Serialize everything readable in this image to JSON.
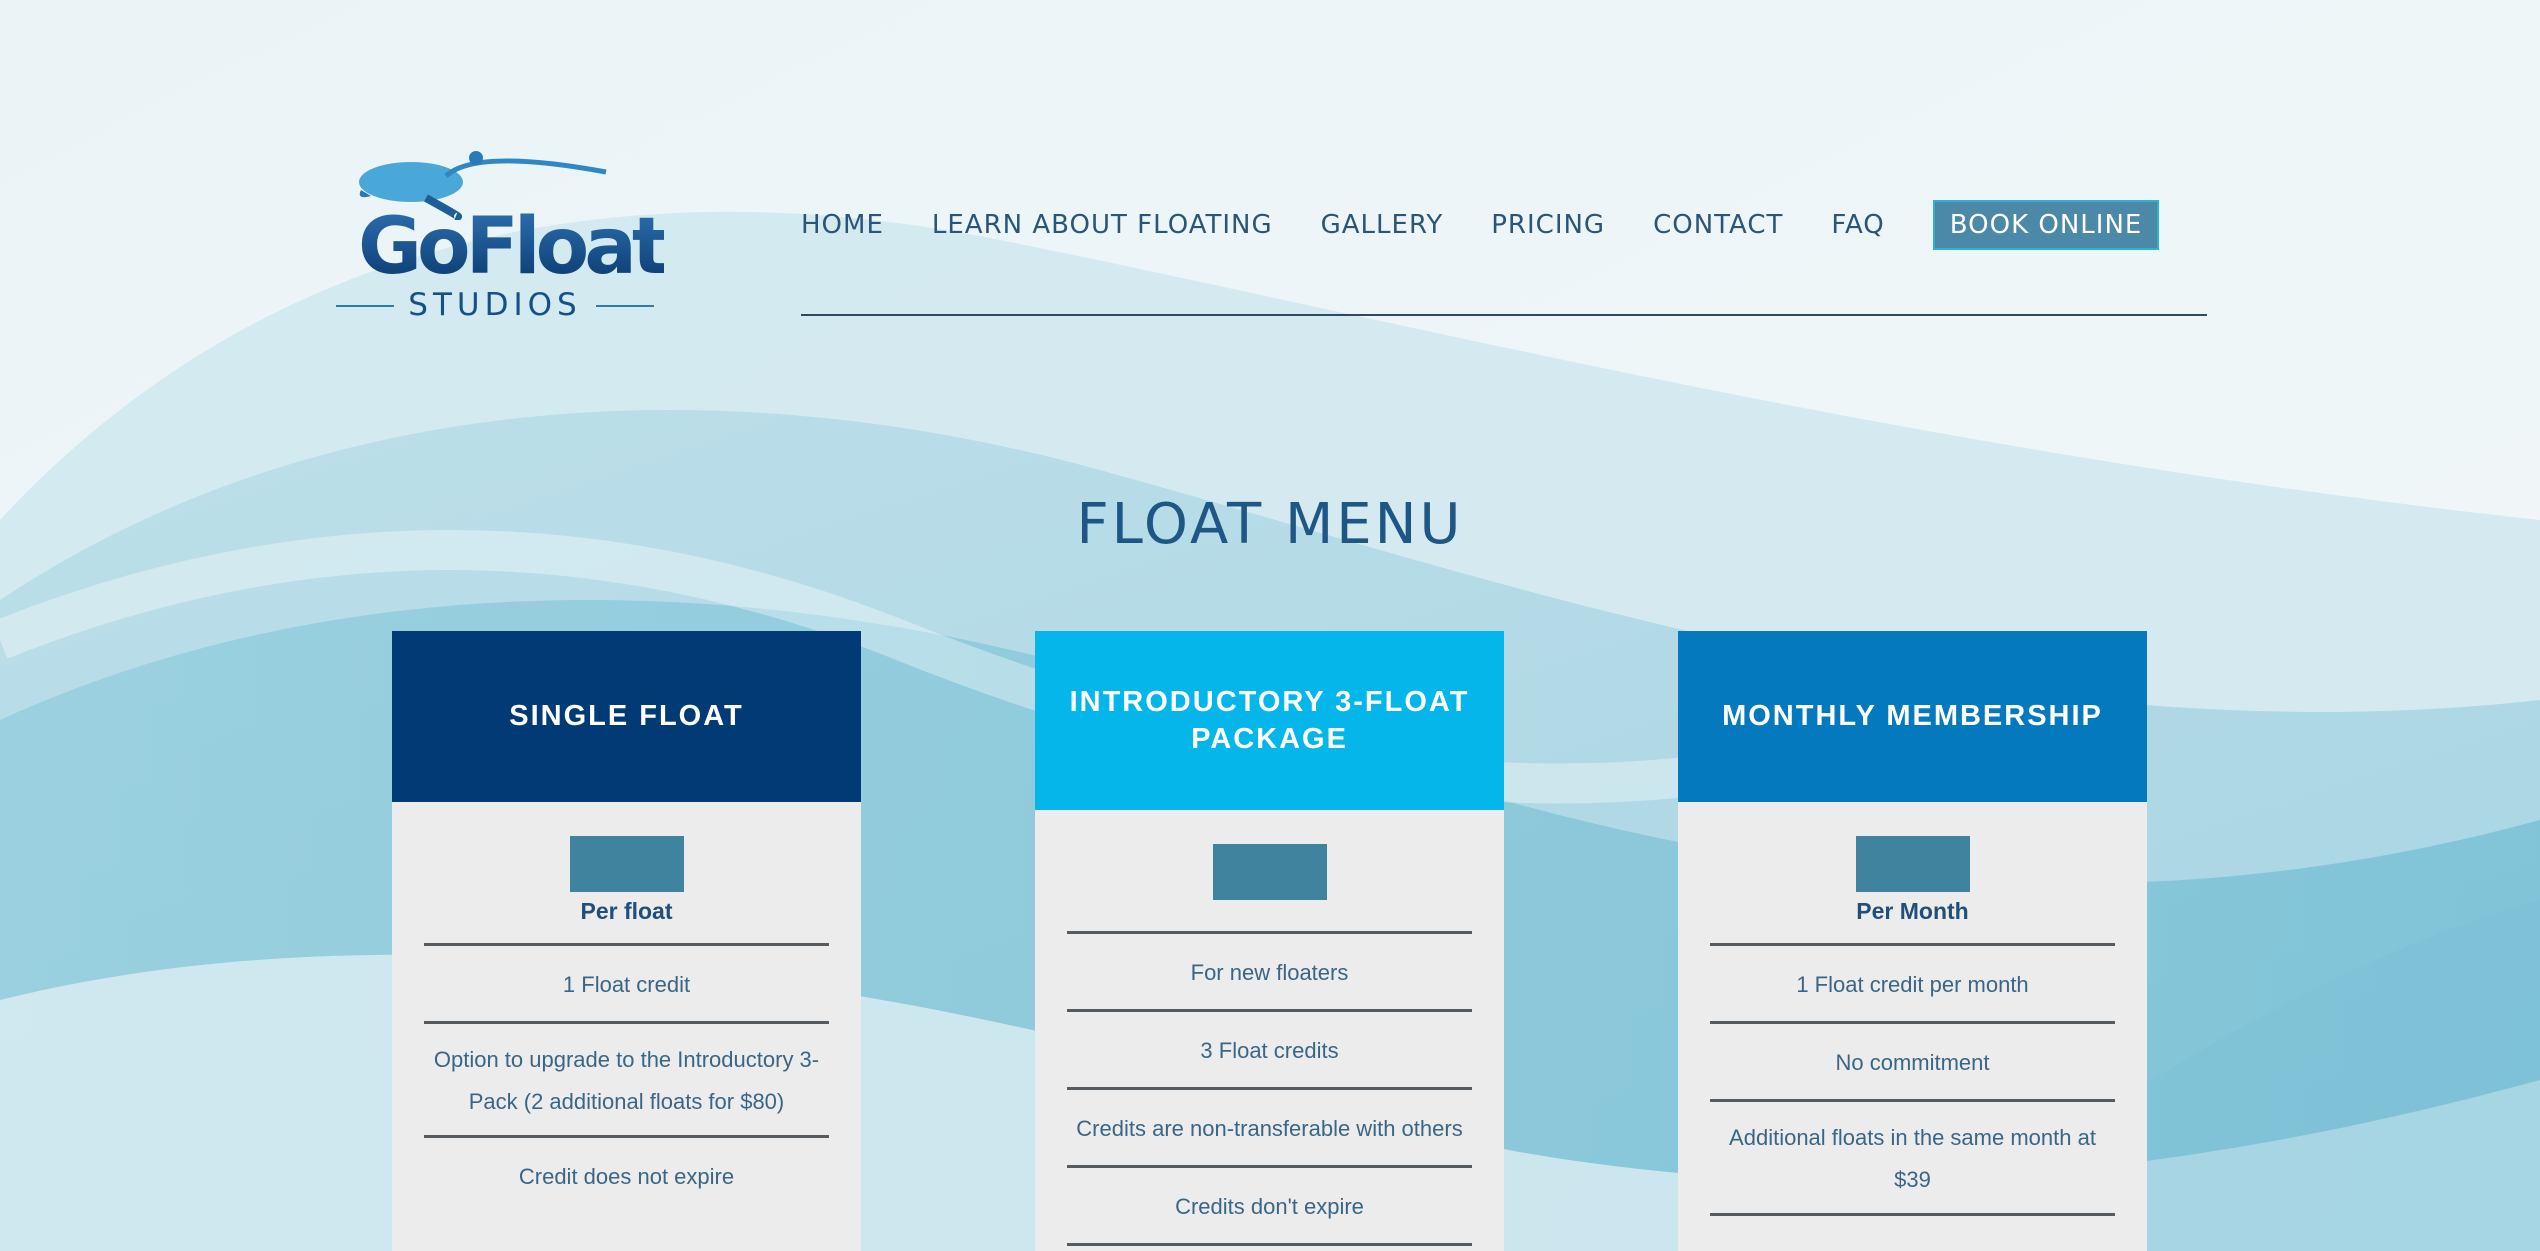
{
  "theme": {
    "nav_color": "#2b5577",
    "book_button_bg": "#4c88a8",
    "title_color": "#1e5685",
    "card_single_header": "#023a75",
    "card_intro_header": "#04b6ea",
    "card_monthly_header": "#0479bd",
    "card_body_bg": "#ececec",
    "price_box_color": "#3f839f"
  },
  "logo": {
    "main": "GoFloat",
    "sub": "STUDIOS",
    "icon": "turtle-icon"
  },
  "nav": {
    "items": [
      "HOME",
      "LEARN ABOUT FLOATING",
      "GALLERY",
      "PRICING",
      "CONTACT",
      "FAQ"
    ],
    "book_label": "BOOK ONLINE"
  },
  "page_title": "FLOAT MENU",
  "cards": [
    {
      "title": "SINGLE FLOAT",
      "price_label": "Per float",
      "features": [
        "1 Float credit",
        "Option to upgrade to the Introductory 3-Pack (2 additional floats for $80)",
        "Credit does not expire"
      ]
    },
    {
      "title": "INTRODUCTORY 3-FLOAT PACKAGE",
      "price_label": "",
      "features": [
        "For new floaters",
        "3 Float credits",
        "Credits are non-transferable with others",
        "Credits don't expire"
      ]
    },
    {
      "title": "MONTHLY MEMBERSHIP",
      "price_label": "Per Month",
      "features": [
        "1 Float credit per month",
        "No commitment",
        "Additional floats in the same month at $39"
      ]
    }
  ]
}
